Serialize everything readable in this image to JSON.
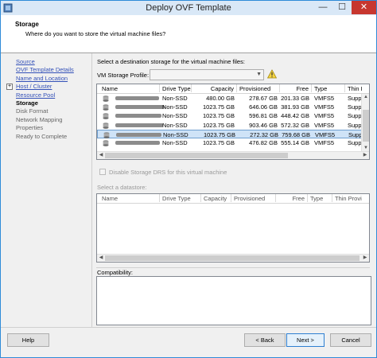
{
  "window": {
    "title": "Deploy OVF Template",
    "minimize": "—",
    "maximize": "☐",
    "close": "✕"
  },
  "header": {
    "title": "Storage",
    "subtitle": "Where do you want to store the virtual machine files?"
  },
  "steps": [
    {
      "label": "Source",
      "state": "link"
    },
    {
      "label": "OVF Template Details",
      "state": "link"
    },
    {
      "label": "Name and Location",
      "state": "link"
    },
    {
      "label": "Host / Cluster",
      "state": "link",
      "expander": "+"
    },
    {
      "label": "Resource Pool",
      "state": "link"
    },
    {
      "label": "Storage",
      "state": "current"
    },
    {
      "label": "Disk Format",
      "state": "future"
    },
    {
      "label": "Network Mapping",
      "state": "future"
    },
    {
      "label": "Properties",
      "state": "future"
    },
    {
      "label": "Ready to Complete",
      "state": "future"
    }
  ],
  "main": {
    "dest_label": "Select a destination storage for the virtual machine files:",
    "profile_label": "VM Storage Profile:",
    "profile_value": "",
    "datastores": {
      "columns": [
        "Name",
        "Drive Type",
        "Capacity",
        "Provisioned",
        "Free",
        "Type",
        "Thin I"
      ],
      "rows": [
        {
          "drive_type": "Non-SSD",
          "capacity": "480.00 GB",
          "provisioned": "278.67 GB",
          "free": "201.33 GB",
          "type": "VMFS5",
          "thin": "Supp",
          "selected": false
        },
        {
          "drive_type": "Non-SSD",
          "capacity": "1023.75 GB",
          "provisioned": "646.06 GB",
          "free": "381.93 GB",
          "type": "VMFS5",
          "thin": "Supp",
          "selected": false
        },
        {
          "drive_type": "Non-SSD",
          "capacity": "1023.75 GB",
          "provisioned": "596.81 GB",
          "free": "448.42 GB",
          "type": "VMFS5",
          "thin": "Supp",
          "selected": false
        },
        {
          "drive_type": "Non-SSD",
          "capacity": "1023.75 GB",
          "provisioned": "903.46 GB",
          "free": "572.32 GB",
          "type": "VMFS5",
          "thin": "Supp",
          "selected": false
        },
        {
          "drive_type": "Non-SSD",
          "capacity": "1023.75 GB",
          "provisioned": "272.32 GB",
          "free": "759.68 GB",
          "type": "VMFS5",
          "thin": "Supp",
          "selected": true
        },
        {
          "drive_type": "Non-SSD",
          "capacity": "1023.75 GB",
          "provisioned": "476.82 GB",
          "free": "555.14 GB",
          "type": "VMFS5",
          "thin": "Supp",
          "selected": false
        }
      ]
    },
    "sdrs_label": "Disable Storage DRS for this virtual machine",
    "select_datastore_label": "Select a datastore:",
    "datastore_columns": [
      "Name",
      "Drive Type",
      "Capacity",
      "Provisioned",
      "Free",
      "Type",
      "Thin Provi"
    ],
    "compatibility_label": "Compatibility:"
  },
  "footer": {
    "help": "Help",
    "back": "< Back",
    "next": "Next >",
    "cancel": "Cancel"
  },
  "icons": {
    "app": "vsphere-icon",
    "warning": "warning-icon",
    "datastore": "datastore-icon"
  },
  "colors": {
    "accent": "#2e8bd8",
    "selected_row": "#cfe3f7",
    "link": "#3451b8",
    "close": "#c7372f"
  }
}
